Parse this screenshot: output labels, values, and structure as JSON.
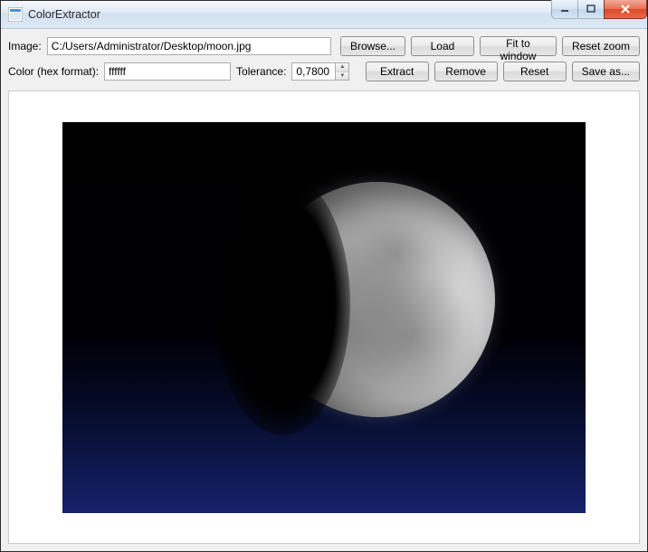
{
  "title": "ColorExtractor",
  "row1": {
    "image_label": "Image:",
    "image_value": "C:/Users/Administrator/Desktop/moon.jpg",
    "browse": "Browse...",
    "load": "Load",
    "fit": "Fit to window",
    "reset_zoom": "Reset zoom"
  },
  "row2": {
    "color_label": "Color (hex format):",
    "color_value": "ffffff",
    "tolerance_label": "Tolerance:",
    "tolerance_value": "0,7800",
    "extract": "Extract",
    "remove": "Remove",
    "reset": "Reset",
    "save_as": "Save as..."
  }
}
